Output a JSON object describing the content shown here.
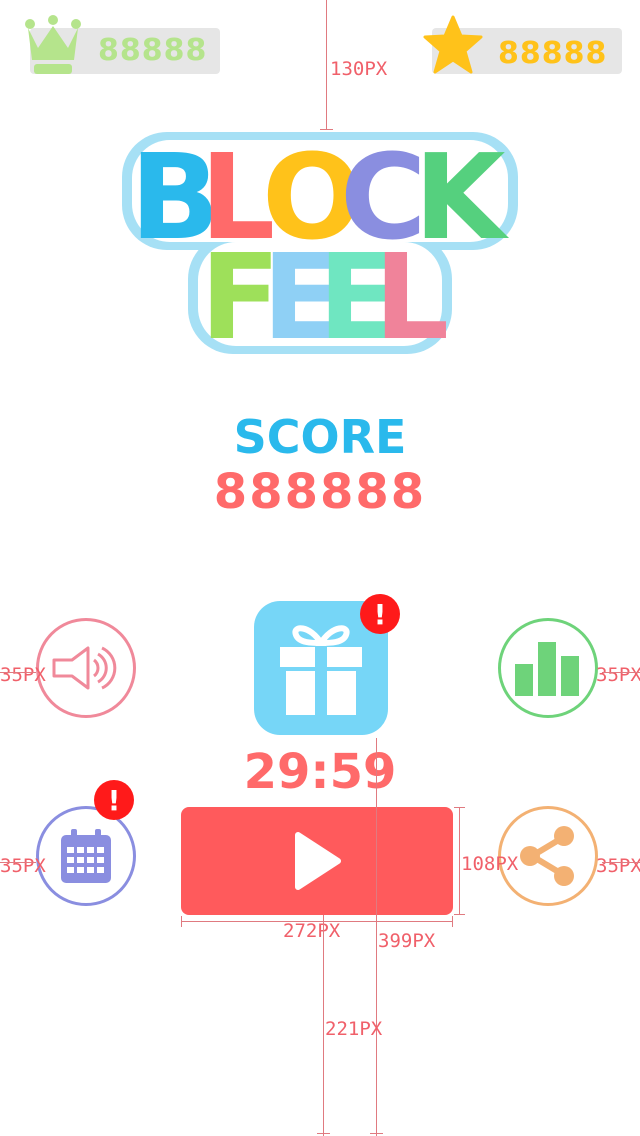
{
  "hud": {
    "best_score": "88888",
    "stars": "88888",
    "crown_icon": "crown-icon",
    "star_icon": "star-icon"
  },
  "logo": {
    "line1": [
      "B",
      "L",
      "O",
      "C",
      "K"
    ],
    "line2": [
      "F",
      "E",
      "E",
      "L"
    ],
    "colors_line1": [
      "#2ab9ec",
      "#ff6a6a",
      "#ffc21a",
      "#8a8ee0",
      "#55d07e"
    ],
    "colors_line2": [
      "#9ee05a",
      "#8fd0f5",
      "#6fe6c1",
      "#f0839a"
    ],
    "outline_color": "#a6e0f5"
  },
  "score": {
    "label": "SCORE",
    "value": "888888"
  },
  "gift": {
    "timer": "29:59",
    "badge": "!"
  },
  "buttons": {
    "sound_icon": "speaker-icon",
    "leaderboard_icon": "bar-chart-icon",
    "calendar_icon": "calendar-icon",
    "share_icon": "share-icon",
    "play_icon": "play-icon",
    "calendar_badge": "!"
  },
  "annotations": {
    "top_gap": "130PX",
    "left_margin_top": "35PX",
    "right_margin_top": "35PX",
    "left_margin_bottom": "35PX",
    "right_margin_bottom": "35PX",
    "play_height": "108PX",
    "play_width": "272PX",
    "right_offset": "399PX",
    "bottom_gap": "221PX"
  },
  "colors": {
    "crown": "#b5e48c",
    "star": "#ffc21a",
    "score_label": "#2ab9ec",
    "score_value": "#ff6a6a",
    "play": "#ff5a5c",
    "gift_bg": "#76d6f7",
    "sound": "#f0899a",
    "leaderboard": "#6ed37a",
    "calendar": "#8a8ee0",
    "share": "#f3b173",
    "annotation": "#f0606a"
  }
}
